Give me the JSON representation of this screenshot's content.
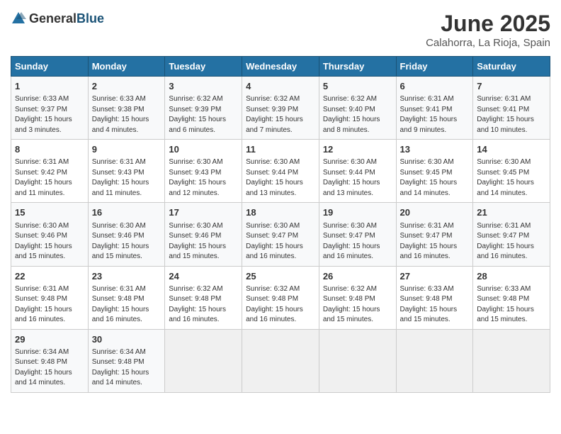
{
  "logo": {
    "general": "General",
    "blue": "Blue"
  },
  "header": {
    "title": "June 2025",
    "subtitle": "Calahorra, La Rioja, Spain"
  },
  "weekdays": [
    "Sunday",
    "Monday",
    "Tuesday",
    "Wednesday",
    "Thursday",
    "Friday",
    "Saturday"
  ],
  "weeks": [
    [
      {
        "day": "1",
        "sunrise": "6:33 AM",
        "sunset": "9:37 PM",
        "daylight": "15 hours and 3 minutes."
      },
      {
        "day": "2",
        "sunrise": "6:33 AM",
        "sunset": "9:38 PM",
        "daylight": "15 hours and 4 minutes."
      },
      {
        "day": "3",
        "sunrise": "6:32 AM",
        "sunset": "9:39 PM",
        "daylight": "15 hours and 6 minutes."
      },
      {
        "day": "4",
        "sunrise": "6:32 AM",
        "sunset": "9:39 PM",
        "daylight": "15 hours and 7 minutes."
      },
      {
        "day": "5",
        "sunrise": "6:32 AM",
        "sunset": "9:40 PM",
        "daylight": "15 hours and 8 minutes."
      },
      {
        "day": "6",
        "sunrise": "6:31 AM",
        "sunset": "9:41 PM",
        "daylight": "15 hours and 9 minutes."
      },
      {
        "day": "7",
        "sunrise": "6:31 AM",
        "sunset": "9:41 PM",
        "daylight": "15 hours and 10 minutes."
      }
    ],
    [
      {
        "day": "8",
        "sunrise": "6:31 AM",
        "sunset": "9:42 PM",
        "daylight": "15 hours and 11 minutes."
      },
      {
        "day": "9",
        "sunrise": "6:31 AM",
        "sunset": "9:43 PM",
        "daylight": "15 hours and 11 minutes."
      },
      {
        "day": "10",
        "sunrise": "6:30 AM",
        "sunset": "9:43 PM",
        "daylight": "15 hours and 12 minutes."
      },
      {
        "day": "11",
        "sunrise": "6:30 AM",
        "sunset": "9:44 PM",
        "daylight": "15 hours and 13 minutes."
      },
      {
        "day": "12",
        "sunrise": "6:30 AM",
        "sunset": "9:44 PM",
        "daylight": "15 hours and 13 minutes."
      },
      {
        "day": "13",
        "sunrise": "6:30 AM",
        "sunset": "9:45 PM",
        "daylight": "15 hours and 14 minutes."
      },
      {
        "day": "14",
        "sunrise": "6:30 AM",
        "sunset": "9:45 PM",
        "daylight": "15 hours and 14 minutes."
      }
    ],
    [
      {
        "day": "15",
        "sunrise": "6:30 AM",
        "sunset": "9:46 PM",
        "daylight": "15 hours and 15 minutes."
      },
      {
        "day": "16",
        "sunrise": "6:30 AM",
        "sunset": "9:46 PM",
        "daylight": "15 hours and 15 minutes."
      },
      {
        "day": "17",
        "sunrise": "6:30 AM",
        "sunset": "9:46 PM",
        "daylight": "15 hours and 15 minutes."
      },
      {
        "day": "18",
        "sunrise": "6:30 AM",
        "sunset": "9:47 PM",
        "daylight": "15 hours and 16 minutes."
      },
      {
        "day": "19",
        "sunrise": "6:30 AM",
        "sunset": "9:47 PM",
        "daylight": "15 hours and 16 minutes."
      },
      {
        "day": "20",
        "sunrise": "6:31 AM",
        "sunset": "9:47 PM",
        "daylight": "15 hours and 16 minutes."
      },
      {
        "day": "21",
        "sunrise": "6:31 AM",
        "sunset": "9:47 PM",
        "daylight": "15 hours and 16 minutes."
      }
    ],
    [
      {
        "day": "22",
        "sunrise": "6:31 AM",
        "sunset": "9:48 PM",
        "daylight": "15 hours and 16 minutes."
      },
      {
        "day": "23",
        "sunrise": "6:31 AM",
        "sunset": "9:48 PM",
        "daylight": "15 hours and 16 minutes."
      },
      {
        "day": "24",
        "sunrise": "6:32 AM",
        "sunset": "9:48 PM",
        "daylight": "15 hours and 16 minutes."
      },
      {
        "day": "25",
        "sunrise": "6:32 AM",
        "sunset": "9:48 PM",
        "daylight": "15 hours and 16 minutes."
      },
      {
        "day": "26",
        "sunrise": "6:32 AM",
        "sunset": "9:48 PM",
        "daylight": "15 hours and 15 minutes."
      },
      {
        "day": "27",
        "sunrise": "6:33 AM",
        "sunset": "9:48 PM",
        "daylight": "15 hours and 15 minutes."
      },
      {
        "day": "28",
        "sunrise": "6:33 AM",
        "sunset": "9:48 PM",
        "daylight": "15 hours and 15 minutes."
      }
    ],
    [
      {
        "day": "29",
        "sunrise": "6:34 AM",
        "sunset": "9:48 PM",
        "daylight": "15 hours and 14 minutes."
      },
      {
        "day": "30",
        "sunrise": "6:34 AM",
        "sunset": "9:48 PM",
        "daylight": "15 hours and 14 minutes."
      },
      null,
      null,
      null,
      null,
      null
    ]
  ],
  "labels": {
    "sunrise": "Sunrise:",
    "sunset": "Sunset:",
    "daylight": "Daylight:"
  }
}
